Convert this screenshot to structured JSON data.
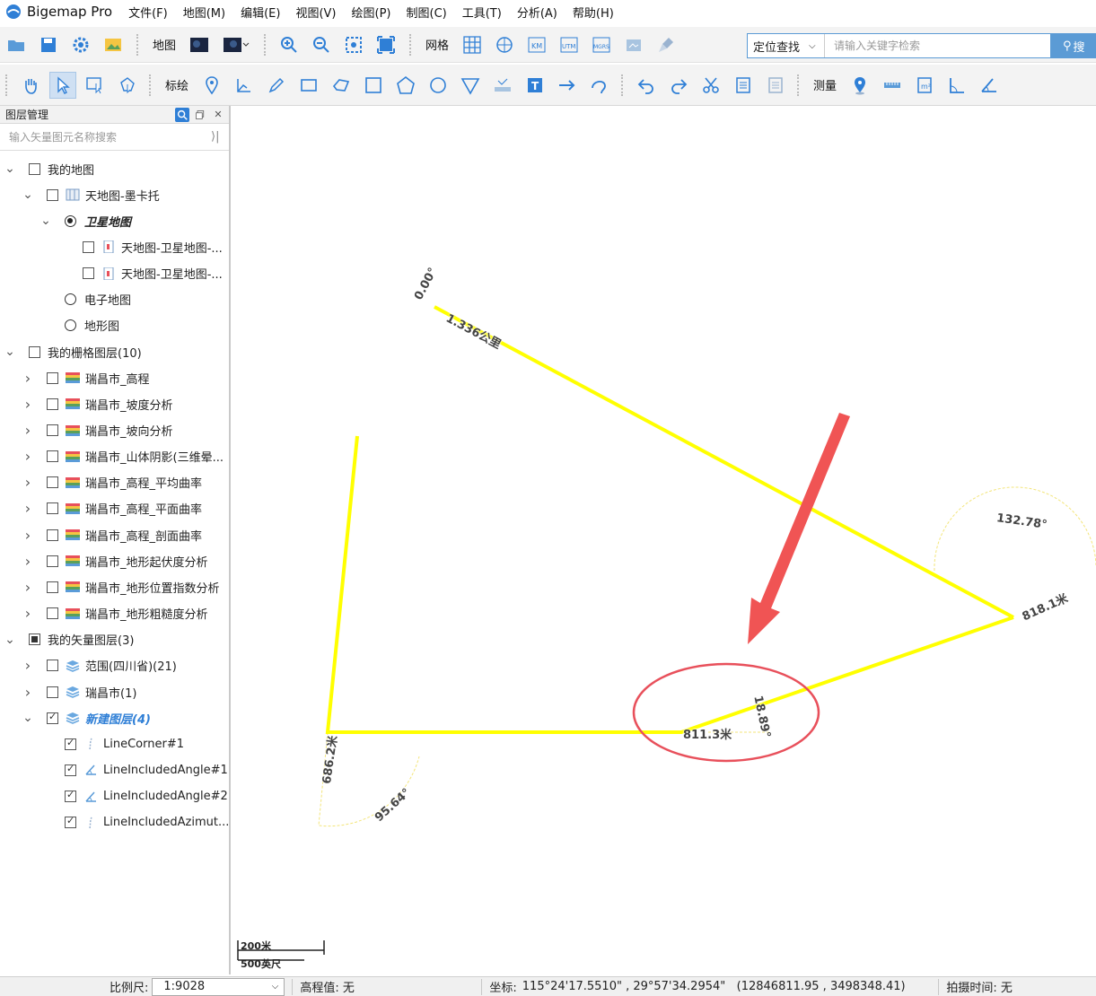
{
  "app": {
    "title": "Bigemap Pro",
    "menu": [
      "文件(F)",
      "地图(M)",
      "编辑(E)",
      "视图(V)",
      "绘图(P)",
      "制图(C)",
      "工具(T)",
      "分析(A)",
      "帮助(H)"
    ]
  },
  "toolbar1": {
    "map_label": "地图",
    "grid_label": "网格",
    "search_scope": "定位查找",
    "search_placeholder": "请输入关键字检索",
    "search_button": "搜"
  },
  "toolbar2": {
    "draw_label": "标绘",
    "measure_label": "测量"
  },
  "layer_panel": {
    "title": "图层管理",
    "search_placeholder": "输入矢量图元名称搜索",
    "nodes": [
      {
        "label": "我的地图",
        "level": 0,
        "caret": "down",
        "control": "checkbox",
        "state": "unchecked",
        "icon": "none",
        "style": "normal"
      },
      {
        "label": "天地图-墨卡托",
        "level": 1,
        "caret": "down",
        "control": "checkbox",
        "state": "unchecked",
        "icon": "map-icon",
        "style": "normal"
      },
      {
        "label": "卫星地图",
        "level": 2,
        "caret": "down",
        "control": "radio",
        "state": "on",
        "icon": "none",
        "style": "bold-italic"
      },
      {
        "label": "天地图-卫星地图-...",
        "level": 3,
        "caret": "none",
        "control": "checkbox",
        "state": "unchecked",
        "icon": "file-icon",
        "style": "normal"
      },
      {
        "label": "天地图-卫星地图-...",
        "level": 3,
        "caret": "none",
        "control": "checkbox",
        "state": "unchecked",
        "icon": "file-icon",
        "style": "normal"
      },
      {
        "label": "电子地图",
        "level": 2,
        "caret": "none",
        "control": "radio",
        "state": "off",
        "icon": "none",
        "style": "normal"
      },
      {
        "label": "地形图",
        "level": 2,
        "caret": "none",
        "control": "radio",
        "state": "off",
        "icon": "none",
        "style": "normal"
      },
      {
        "label": "我的栅格图层(10)",
        "level": 0,
        "caret": "down",
        "control": "checkbox",
        "state": "unchecked",
        "icon": "none",
        "style": "normal"
      },
      {
        "label": "瑞昌市_高程",
        "level": 1,
        "caret": "right",
        "control": "checkbox",
        "state": "unchecked",
        "icon": "raster-icon",
        "style": "normal"
      },
      {
        "label": "瑞昌市_坡度分析",
        "level": 1,
        "caret": "right",
        "control": "checkbox",
        "state": "unchecked",
        "icon": "raster-icon",
        "style": "normal"
      },
      {
        "label": "瑞昌市_坡向分析",
        "level": 1,
        "caret": "right",
        "control": "checkbox",
        "state": "unchecked",
        "icon": "raster-icon",
        "style": "normal"
      },
      {
        "label": "瑞昌市_山体阴影(三维晕...",
        "level": 1,
        "caret": "right",
        "control": "checkbox",
        "state": "unchecked",
        "icon": "raster-icon",
        "style": "normal"
      },
      {
        "label": "瑞昌市_高程_平均曲率",
        "level": 1,
        "caret": "right",
        "control": "checkbox",
        "state": "unchecked",
        "icon": "raster-icon",
        "style": "normal"
      },
      {
        "label": "瑞昌市_高程_平面曲率",
        "level": 1,
        "caret": "right",
        "control": "checkbox",
        "state": "unchecked",
        "icon": "raster-icon",
        "style": "normal"
      },
      {
        "label": "瑞昌市_高程_剖面曲率",
        "level": 1,
        "caret": "right",
        "control": "checkbox",
        "state": "unchecked",
        "icon": "raster-icon",
        "style": "normal"
      },
      {
        "label": "瑞昌市_地形起伏度分析",
        "level": 1,
        "caret": "right",
        "control": "checkbox",
        "state": "unchecked",
        "icon": "raster-icon",
        "style": "normal"
      },
      {
        "label": "瑞昌市_地形位置指数分析",
        "level": 1,
        "caret": "right",
        "control": "checkbox",
        "state": "unchecked",
        "icon": "raster-icon",
        "style": "normal"
      },
      {
        "label": "瑞昌市_地形粗糙度分析",
        "level": 1,
        "caret": "right",
        "control": "checkbox",
        "state": "unchecked",
        "icon": "raster-icon",
        "style": "normal"
      },
      {
        "label": "我的矢量图层(3)",
        "level": 0,
        "caret": "down",
        "control": "checkbox",
        "state": "partial",
        "icon": "none",
        "style": "normal"
      },
      {
        "label": "范围(四川省)(21)",
        "level": 1,
        "caret": "right",
        "control": "checkbox",
        "state": "unchecked",
        "icon": "layers-icon",
        "style": "normal"
      },
      {
        "label": "瑞昌市(1)",
        "level": 1,
        "caret": "right",
        "control": "checkbox",
        "state": "unchecked",
        "icon": "layers-icon",
        "style": "normal"
      },
      {
        "label": "新建图层(4)",
        "level": 1,
        "caret": "down",
        "control": "checkbox",
        "state": "checked",
        "icon": "layers-icon",
        "style": "blue-italic"
      },
      {
        "label": "LineCorner#1",
        "level": 2,
        "caret": "none",
        "control": "checkbox",
        "state": "checked",
        "icon": "line-icon",
        "style": "normal"
      },
      {
        "label": "LineIncludedAngle#1",
        "level": 2,
        "caret": "none",
        "control": "checkbox",
        "state": "checked",
        "icon": "angle-icon",
        "style": "normal"
      },
      {
        "label": "LineIncludedAngle#2",
        "level": 2,
        "caret": "none",
        "control": "checkbox",
        "state": "checked",
        "icon": "angle-icon",
        "style": "normal"
      },
      {
        "label": "LineIncludedAzimut...",
        "level": 2,
        "caret": "none",
        "control": "checkbox",
        "state": "checked",
        "icon": "line-icon",
        "style": "normal"
      }
    ]
  },
  "map": {
    "line_color": "#ffff00",
    "highlight_color": "#e8505b",
    "labels": {
      "angle_top": "0.00°",
      "distance_top": "1.336公里",
      "angle_right": "132.78°",
      "distance_right": "818.1米",
      "angle_mid": "18.89°",
      "distance_mid": "811.3米",
      "distance_left": "686.2米",
      "angle_left": "95.64°"
    },
    "scalebar": {
      "top": "200米",
      "bottom": "500英尺"
    }
  },
  "statusbar": {
    "scale_label": "比例尺:",
    "scale_value": "1:9028",
    "elevation_label": "高程值: 无",
    "coord_label": "坐标:",
    "coord_value": "115°24'17.5510\" , 29°57'34.2954\"   (12846811.95 , 3498348.41)",
    "capture_time": "拍摄时间: 无"
  }
}
